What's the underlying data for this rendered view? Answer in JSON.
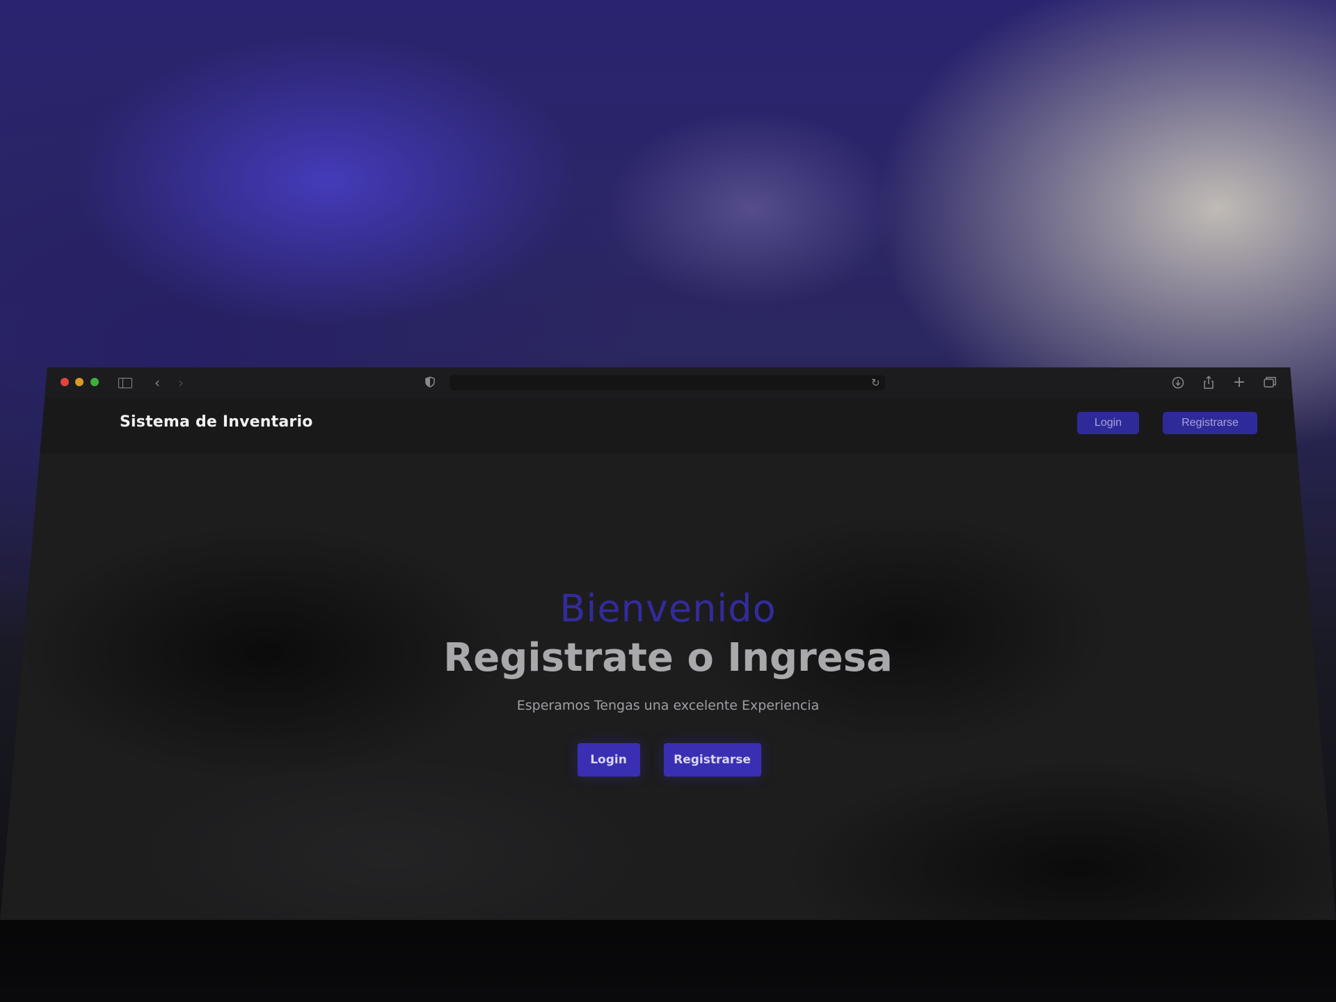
{
  "site": {
    "brand": "Sistema de Inventario"
  },
  "header_nav": {
    "login_label": "Login",
    "register_label": "Registrarse"
  },
  "hero": {
    "welcome": "Bienvenido",
    "title": "Registrate o Ingresa",
    "subtitle": "Esperamos Tengas una excelente Experiencia",
    "login_label": "Login",
    "register_label": "Registrarse"
  },
  "browser": {
    "address": ""
  },
  "icons": {
    "back": "chevron-left-icon",
    "forward": "chevron-right-icon",
    "sidebar": "sidebar-icon",
    "shield": "shield-icon",
    "reload": "reload-icon",
    "download": "download-icon",
    "share": "share-icon",
    "new_tab": "plus-icon",
    "tabs": "tabs-overview-icon"
  },
  "colors": {
    "accent": "#3a2fb3",
    "welcome_text": "#332b9c",
    "page_background": "#1d1d1e",
    "traffic_red": "#e0443a",
    "traffic_yellow": "#d99a25",
    "traffic_green": "#3fae3c"
  }
}
